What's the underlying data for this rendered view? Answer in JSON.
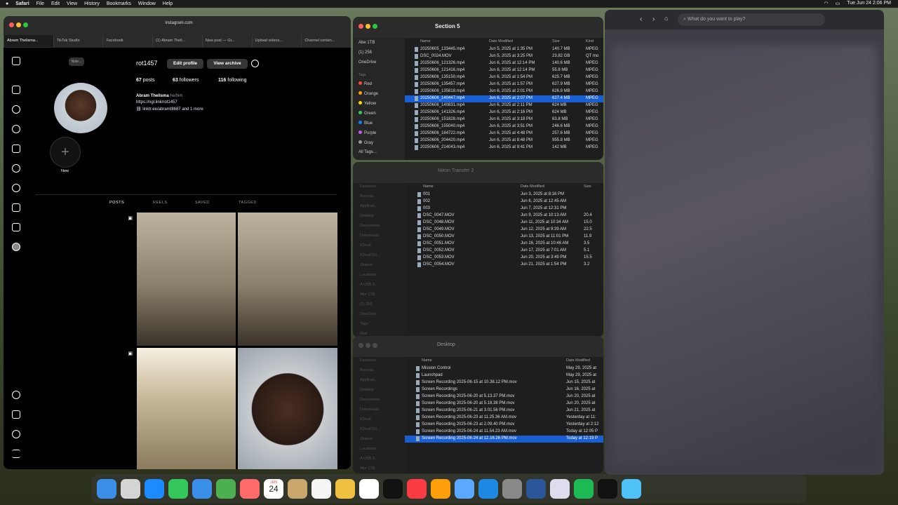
{
  "menubar": {
    "apple": "",
    "items": [
      "Safari",
      "File",
      "Edit",
      "View",
      "History",
      "Bookmarks",
      "Window",
      "Help"
    ],
    "clock": "Tue Jun 24  2:06 PM"
  },
  "safari": {
    "url": "instagram.com",
    "tabs": [
      "Abram Thelisma...",
      "TikTok Studio",
      "Facebook",
      "(1) Abram Theli...",
      "New post — Gr...",
      "Upload videos...",
      "Channel conten..."
    ],
    "note": "Note...",
    "username": "rot1457",
    "edit_profile": "Edit profile",
    "view_archive": "View archive",
    "posts": "67",
    "posts_label": "posts",
    "followers": "63",
    "followers_label": "followers",
    "following": "116",
    "following_label": "following",
    "full_name": "Abram Thelisma",
    "pronouns": "he/him",
    "link1": "https://ngl.link/rot1457",
    "link2": "linktr.ee/abramt8687 and 1 more",
    "new_label": "New",
    "tabs_profile": [
      "POSTS",
      "REELS",
      "SAVED",
      "TAGGED"
    ]
  },
  "finder1": {
    "title": "Section 5",
    "sidebar": [
      "Abe 1TB",
      "(1) 256",
      "OneDrive",
      "Tags",
      "Red",
      "Orange",
      "Yellow",
      "Green",
      "Blue",
      "Purple",
      "Gray",
      "All Tags..."
    ],
    "cols": [
      "Name",
      "Date Modified",
      "Size",
      "Kind"
    ],
    "rows": [
      [
        "20250605_133445.mp4",
        "Jun 5, 2025 at 1:35 PM",
        "140.7 MB",
        "MPEG"
      ],
      [
        "DSC_0024.MOV",
        "Jun 5, 2025 at 3:25 PM",
        "23.82 GB",
        "QT mo"
      ],
      [
        "20250606_121326.mp4",
        "Jun 6, 2025 at 12:14 PM",
        "140.6 MB",
        "MPEG"
      ],
      [
        "20250606_121416.mp4",
        "Jun 6, 2025 at 12:14 PM",
        "55.8 MB",
        "MPEG"
      ],
      [
        "20250606_135150.mp4",
        "Jun 6, 2025 at 1:54 PM",
        "625.7 MB",
        "MPEG"
      ],
      [
        "20250606_135457.mp4",
        "Jun 6, 2025 at 1:57 PM",
        "627.9 MB",
        "MPEG"
      ],
      [
        "20250606_135818.mp4",
        "Jun 6, 2025 at 2:01 PM",
        "626.9 MB",
        "MPEG"
      ],
      [
        "20250606_140447.mp4",
        "Jun 6, 2025 at 2:07 PM",
        "627.4 MB",
        "MPEG"
      ],
      [
        "20250606_140831.mp4",
        "Jun 6, 2025 at 2:11 PM",
        "624 MB",
        "MPEG"
      ],
      [
        "20250606_141326.mp4",
        "Jun 6, 2025 at 2:16 PM",
        "624 MB",
        "MPEG"
      ],
      [
        "20250606_151828.mp4",
        "Jun 6, 2025 at 3:18 PM",
        "63.8 MB",
        "MPEG"
      ],
      [
        "20250606_155040.mp4",
        "Jun 6, 2025 at 3:51 PM",
        "246.6 MB",
        "MPEG"
      ],
      [
        "20250606_164722.mp4",
        "Jun 6, 2025 at 4:48 PM",
        "257.6 MB",
        "MPEG"
      ],
      [
        "20250606_204420.mp4",
        "Jun 6, 2025 at 8:48 PM",
        "955.8 MB",
        "MPEG"
      ],
      [
        "20250606_214043.mp4",
        "Jun 6, 2025 at 9:41 PM",
        "142 MB",
        "MPEG"
      ]
    ]
  },
  "finder2": {
    "title": "Nikon Transfer 2",
    "sidebar": [
      "Favorites",
      "Recents",
      "Applicati...",
      "Desktop",
      "Documents",
      "Downloads",
      "iCloud",
      "iCloud Dri...",
      "Shared",
      "Locations",
      "A USB 3.",
      "Abe 1TB",
      "(1) 256",
      "OneDrive",
      "Tags",
      "Red"
    ],
    "cols": [
      "Name",
      "Date Modified",
      "Size"
    ],
    "rows": [
      [
        "001",
        "Jun 3, 2025 at 8:16 PM",
        ""
      ],
      [
        "002",
        "Jun 6, 2025 at 12:45 AM",
        ""
      ],
      [
        "003",
        "Jun 7, 2025 at 12:31 PM",
        ""
      ],
      [
        "DSC_0047.MOV",
        "Jun 9, 2025 at 10:13 AM",
        "20.4"
      ],
      [
        "DSC_0048.MOV",
        "Jun 11, 2025 at 10:34 AM",
        "15.0"
      ],
      [
        "DSC_0049.MOV",
        "Jun 12, 2025 at 9:39 AM",
        "22.5"
      ],
      [
        "DSC_0050.MOV",
        "Jun 13, 2025 at 11:01 PM",
        "11.9"
      ],
      [
        "DSC_0051.MOV",
        "Jun 16, 2025 at 10:46 AM",
        "3.5"
      ],
      [
        "DSC_0052.MOV",
        "Jun 17, 2025 at 7:01 AM",
        "5.1"
      ],
      [
        "DSC_0053.MOV",
        "Jun 20, 2025 at 3:49 PM",
        "15.5"
      ],
      [
        "DSC_0054.MOV",
        "Jun 21, 2025 at 1:54 PM",
        "3.2"
      ]
    ]
  },
  "finder3": {
    "title": "Desktop",
    "sidebar": [
      "Favorites",
      "Recents",
      "Applicati...",
      "Desktop",
      "Documents",
      "Downloads",
      "iCloud",
      "iCloud Dri...",
      "Shared",
      "Locations",
      "A USB 3.",
      "Abe 1TB"
    ],
    "cols": [
      "Name",
      "Date Modified"
    ],
    "rows": [
      [
        "Mission Control",
        "May 29, 2025 at"
      ],
      [
        "Launchpad",
        "May 29, 2025 at"
      ],
      [
        "Screen Recording 2025-06-15 at 10.38.12 PM.mov",
        "Jun 15, 2025 at"
      ],
      [
        "Screen Recordings",
        "Jun 16, 2025 at"
      ],
      [
        "Screen Recording 2025-06-20 at 5.13.37 PM.mov",
        "Jun 20, 2025 at"
      ],
      [
        "Screen Recording 2025-06-20 at 5.18.38 PM.mov",
        "Jun 20, 2025 at"
      ],
      [
        "Screen Recording 2025-06-21 at 3.01.56 PM.mov",
        "Jun 21, 2025 at"
      ],
      [
        "Screen Recording 2025-06-23 at 11.25.36 AM.mov",
        "Yesterday at 11:"
      ],
      [
        "Screen Recording 2025-06-23 at 2.09.40 PM.mov",
        "Yesterday at 2:12"
      ],
      [
        "Screen Recording 2025-06-24 at 11.54.23 AM.mov",
        "Today at 12:05 P"
      ],
      [
        "Screen Recording 2025-06-24 at 12.16.26 PM.mov",
        "Today at 12:19 P"
      ]
    ]
  },
  "browser2": {
    "search_placeholder": "What do you want to play?"
  },
  "dock": {
    "calendar_month": "JUN",
    "calendar_day": "24",
    "apps": [
      "Finder",
      "Launchpad",
      "Safari",
      "Messages",
      "Mail",
      "Maps",
      "Photos",
      "Calendar",
      "Notes",
      "Reminders",
      "Freeform",
      "Apple TV",
      "Music",
      "Pages",
      "QuickTime",
      "App Store",
      "System Settings",
      "Word",
      "Preview",
      "Spotify",
      "Stocks",
      "Folder",
      "Trash"
    ]
  }
}
